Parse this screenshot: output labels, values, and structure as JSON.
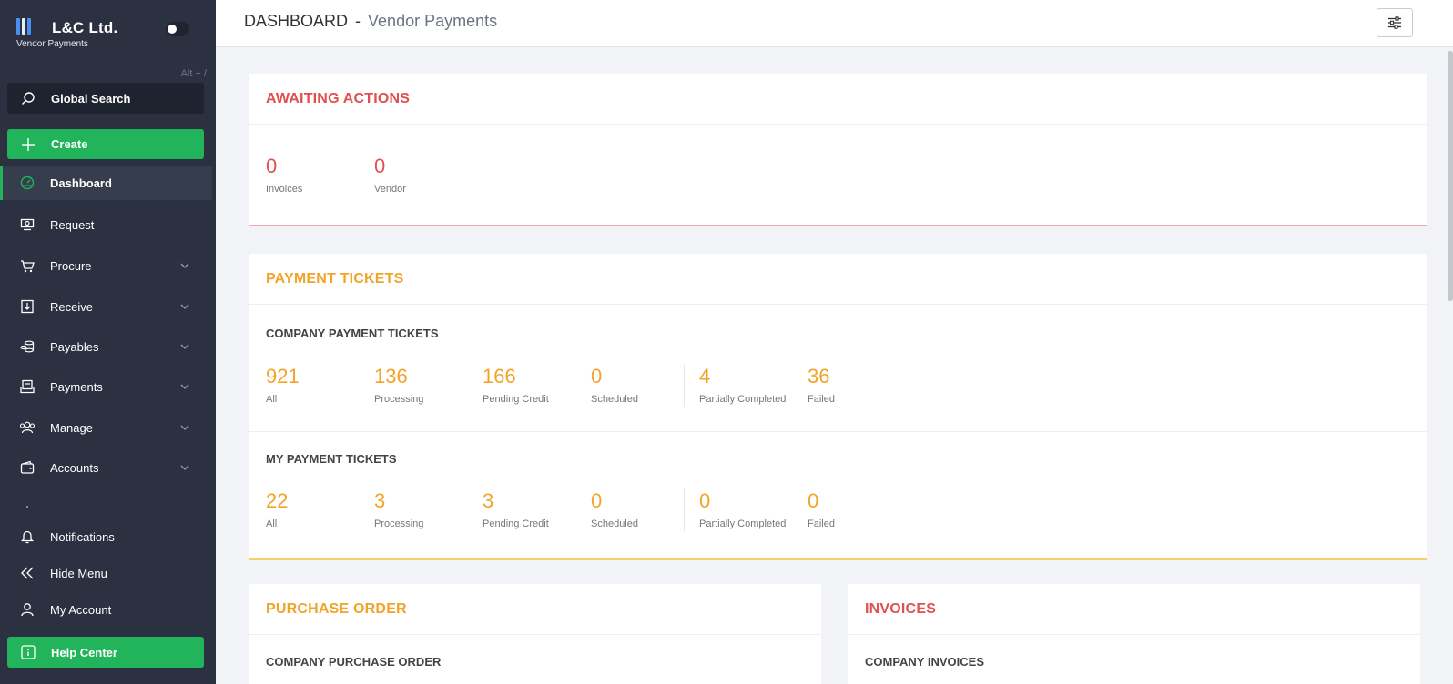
{
  "brand": {
    "name": "L&C Ltd.",
    "subtitle": "Vendor Payments"
  },
  "shortcut_hint": "Alt + /",
  "search": {
    "label": "Global Search"
  },
  "create": {
    "label": "Create"
  },
  "nav": {
    "dashboard": "Dashboard",
    "request": "Request",
    "procure": "Procure",
    "receive": "Receive",
    "payables": "Payables",
    "payments": "Payments",
    "manage": "Manage",
    "accounts": "Accounts",
    "notifications": "Notifications",
    "hide_menu": "Hide Menu",
    "my_account": "My Account",
    "help_center": "Help Center"
  },
  "header": {
    "title": "DASHBOARD",
    "separator": "-",
    "subtitle": "Vendor Payments"
  },
  "awaiting_actions": {
    "title": "AWAITING ACTIONS",
    "stats": [
      {
        "value": "0",
        "label": "Invoices"
      },
      {
        "value": "0",
        "label": "Vendor"
      }
    ]
  },
  "payment_tickets": {
    "title": "PAYMENT TICKETS",
    "company": {
      "title": "COMPANY PAYMENT TICKETS",
      "stats": [
        {
          "value": "921",
          "label": "All"
        },
        {
          "value": "136",
          "label": "Processing"
        },
        {
          "value": "166",
          "label": "Pending Credit"
        },
        {
          "value": "0",
          "label": "Scheduled"
        },
        {
          "value": "4",
          "label": "Partially Completed"
        },
        {
          "value": "36",
          "label": "Failed"
        }
      ]
    },
    "mine": {
      "title": "MY PAYMENT TICKETS",
      "stats": [
        {
          "value": "22",
          "label": "All"
        },
        {
          "value": "3",
          "label": "Processing"
        },
        {
          "value": "3",
          "label": "Pending Credit"
        },
        {
          "value": "0",
          "label": "Scheduled"
        },
        {
          "value": "0",
          "label": "Partially Completed"
        },
        {
          "value": "0",
          "label": "Failed"
        }
      ]
    }
  },
  "purchase_order": {
    "title": "PURCHASE ORDER",
    "section": "COMPANY PURCHASE ORDER"
  },
  "invoices": {
    "title": "INVOICES",
    "section": "COMPANY INVOICES"
  },
  "colors": {
    "accent_green": "#22b45a",
    "sidebar": "#2b3140",
    "red": "#e0504f",
    "orange": "#f2a429"
  }
}
